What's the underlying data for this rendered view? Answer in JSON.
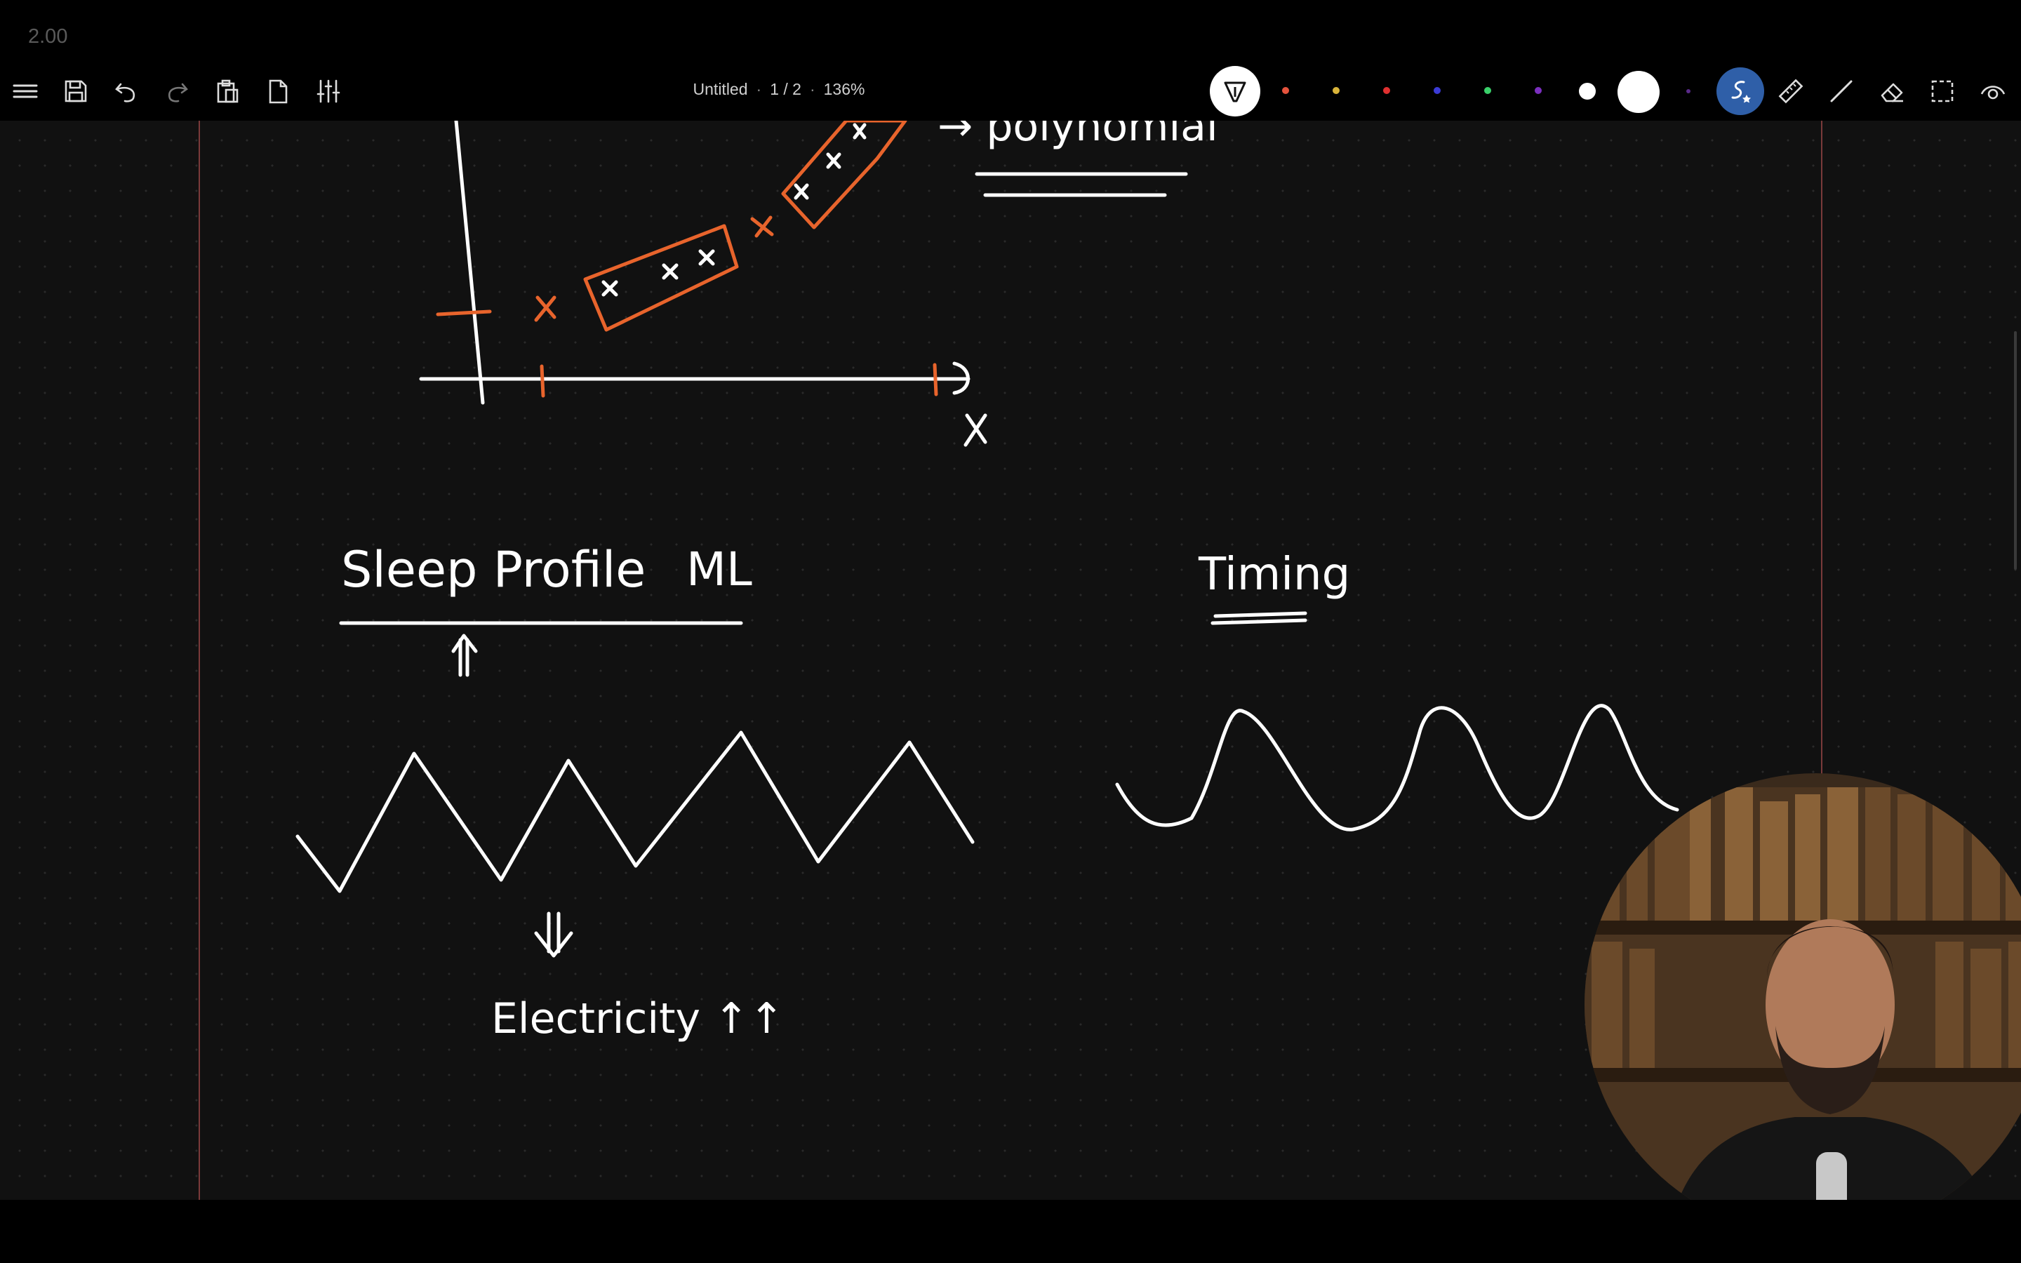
{
  "toolbar": {
    "speed": "2.00",
    "document": {
      "name": "Untitled",
      "page": "1 / 2",
      "zoom": "136%"
    },
    "pen_colors": [
      "#e5533d",
      "#d9b43a",
      "#e03030",
      "#3b3bd6",
      "#3ad06a",
      "#7b2fbf"
    ],
    "accent": "#2f5fa8"
  },
  "board": {
    "text": {
      "x_axis": "x",
      "poly": "→ polynomial",
      "sleep": "Sleep Profile",
      "ml": "ML",
      "up_arrow": "⇑",
      "down_arrow": "⇓",
      "electricity": "Electricity ↑↑",
      "timing": "Timing"
    },
    "stroke_colors": {
      "ink": "#ffffff",
      "highlight": "#e8642c"
    }
  },
  "webcam": {
    "icon": "presenter-video"
  }
}
